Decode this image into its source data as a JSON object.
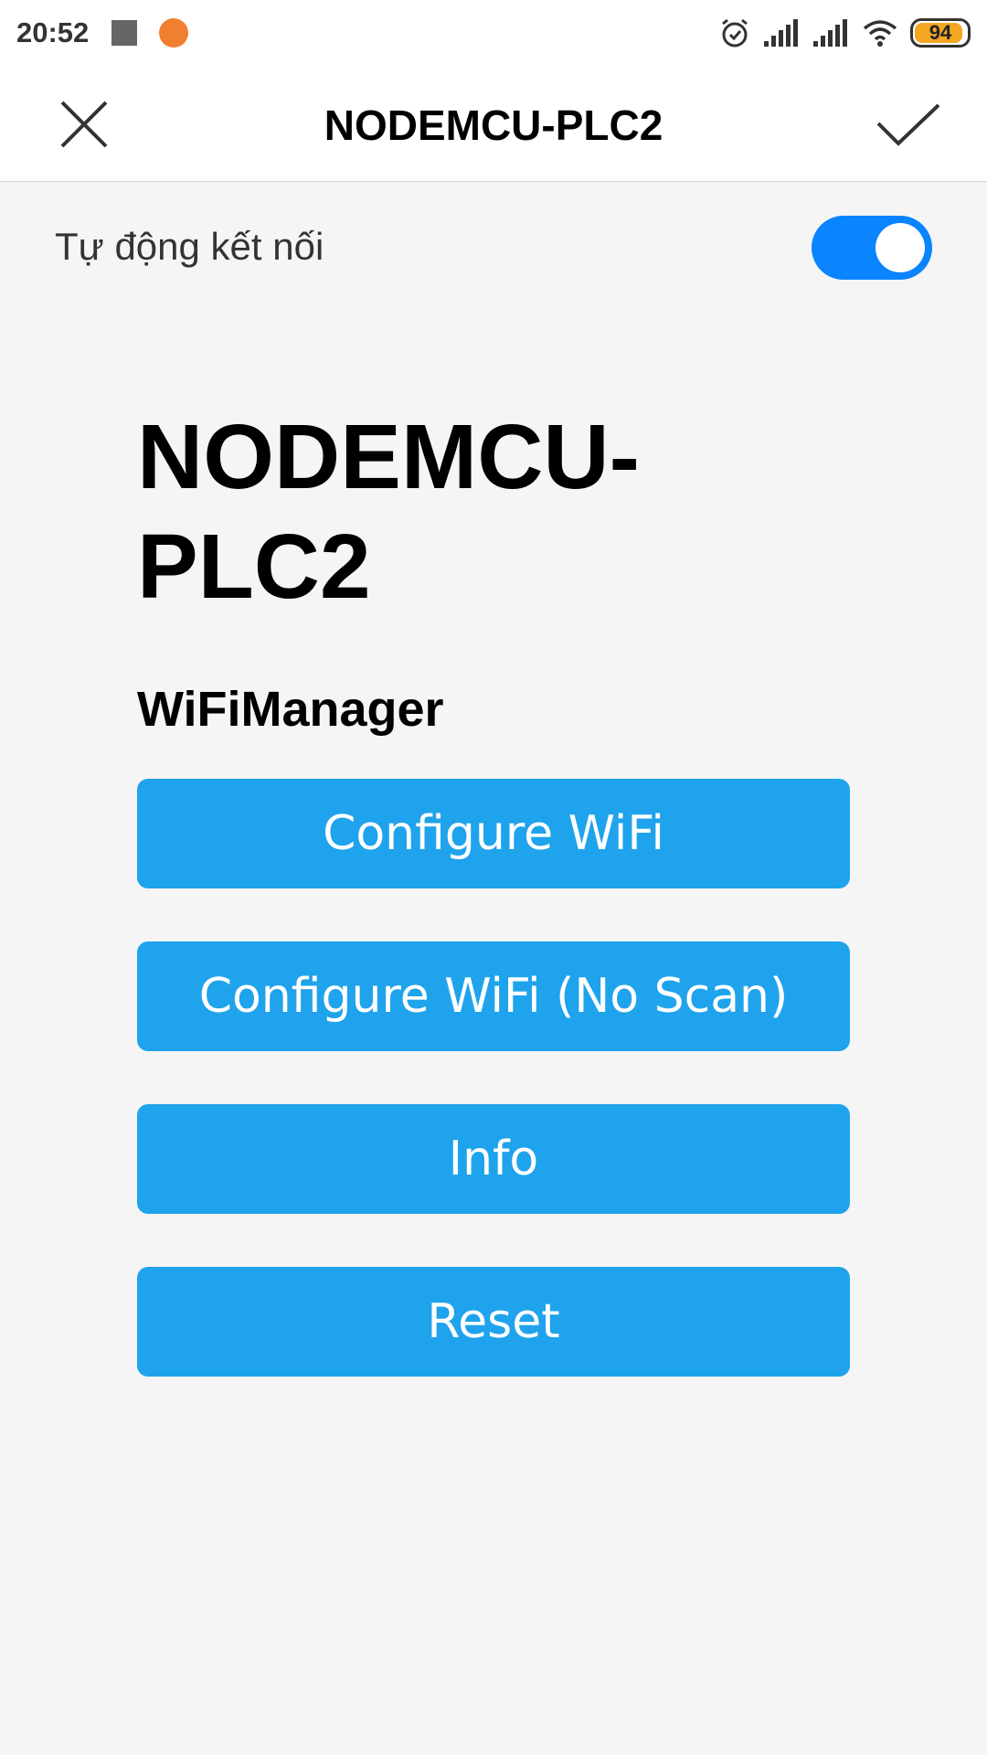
{
  "status_bar": {
    "time": "20:52",
    "battery": "94",
    "battery_level": 0.94,
    "icons": [
      "stop-square-icon",
      "app-notification-icon",
      "alarm-icon",
      "signal-icon",
      "signal-icon",
      "wifi-icon",
      "battery-icon"
    ]
  },
  "app_bar": {
    "title": "NODEMCU-PLC2",
    "close_icon": "close-icon",
    "confirm_icon": "check-icon"
  },
  "auto_connect": {
    "label": "Tự động kết nối",
    "enabled": true,
    "accent": "#0a84ff"
  },
  "portal": {
    "device_title": "NODEMCU-PLC2",
    "heading": "WiFiManager",
    "button_color": "#1fa3ec",
    "buttons": [
      {
        "label": "Configure WiFi"
      },
      {
        "label": "Configure WiFi (No Scan)"
      },
      {
        "label": "Info"
      },
      {
        "label": "Reset"
      }
    ]
  }
}
